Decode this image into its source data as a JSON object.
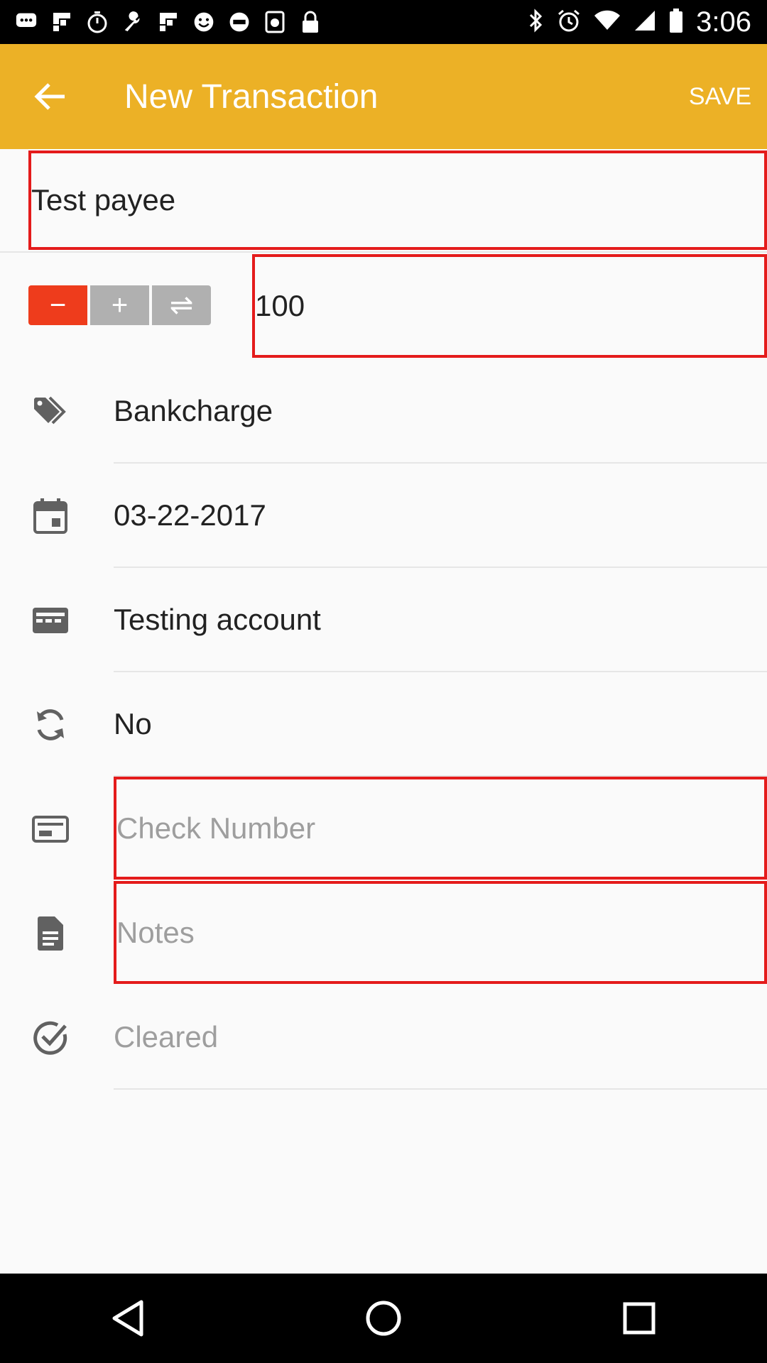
{
  "status_bar": {
    "time": "3:06",
    "icons": [
      "chat-bubble-icon",
      "flipboard-icon",
      "stopwatch-icon",
      "wrench-icon",
      "flipboard-icon",
      "smiley-icon",
      "fox-sports-icon",
      "sports-app-icon",
      "lock-icon",
      "bluetooth-icon",
      "alarm-icon",
      "wifi-icon",
      "signal-icon",
      "battery-icon"
    ]
  },
  "app_bar": {
    "title": "New Transaction",
    "save_label": "SAVE"
  },
  "payee": {
    "value": "Test payee"
  },
  "amount": {
    "value": "100",
    "type_buttons": [
      "−",
      "+",
      "⇌"
    ],
    "active_type": "withdrawal"
  },
  "fields": {
    "category": {
      "value": "Bankcharge",
      "icon": "tag-icon"
    },
    "date": {
      "value": "03-22-2017",
      "icon": "calendar-icon"
    },
    "account": {
      "value": "Testing account",
      "icon": "card-icon"
    },
    "recurring": {
      "value": "No",
      "icon": "sync-icon"
    },
    "check_number": {
      "placeholder": "Check Number",
      "icon": "check-icon"
    },
    "notes": {
      "placeholder": "Notes",
      "icon": "notes-icon"
    },
    "cleared": {
      "placeholder": "Cleared",
      "icon": "check-circle-icon"
    }
  },
  "colors": {
    "app_bar": "#ecb126",
    "accent_red": "#ee3c1c",
    "highlight_border": "#e41b1b"
  }
}
